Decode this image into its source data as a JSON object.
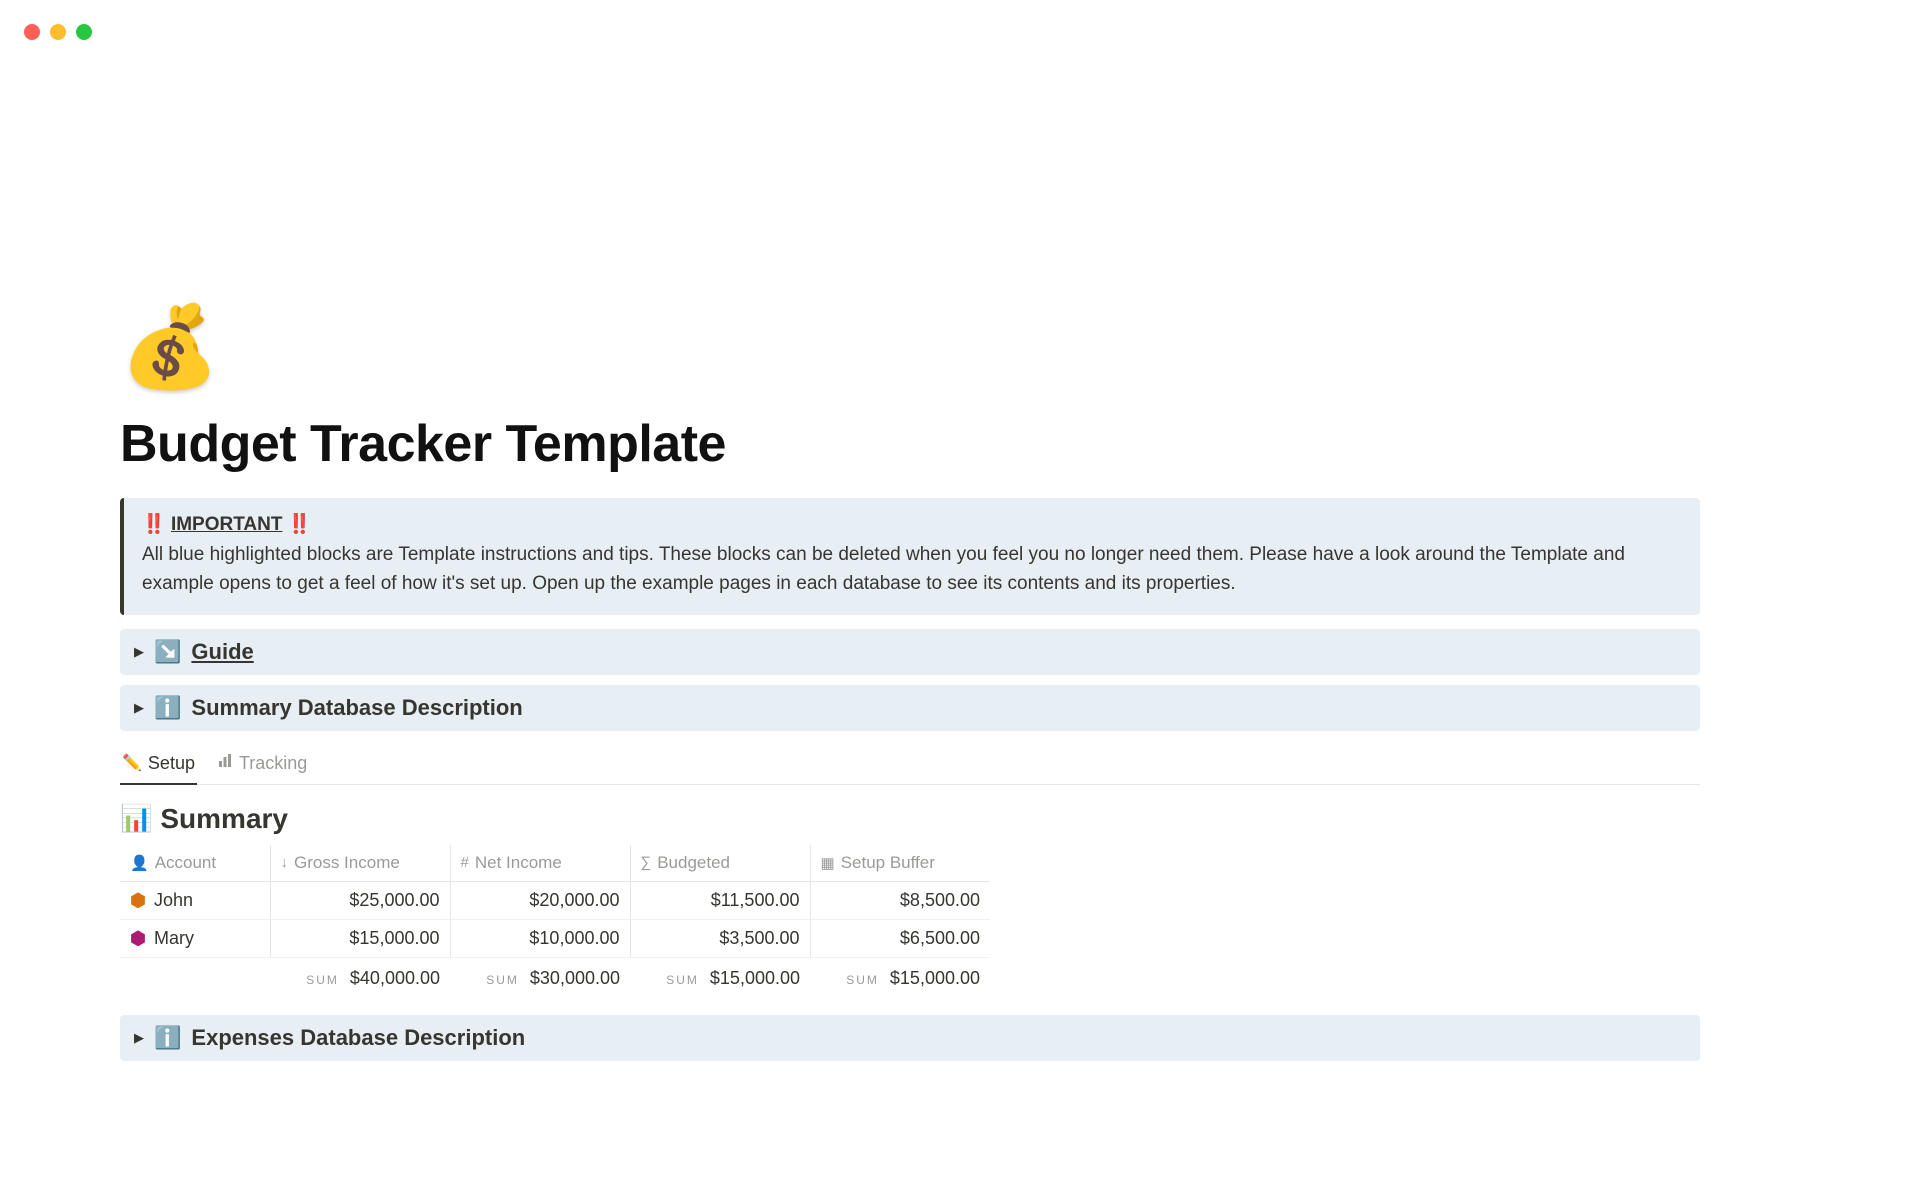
{
  "window": {
    "close": "close",
    "min": "minimize",
    "max": "maximize"
  },
  "page": {
    "icon": "💰",
    "title": "Budget Tracker Template"
  },
  "callout": {
    "alert_emoji": "‼️",
    "title": "IMPORTANT",
    "alert_emoji_2": "‼️",
    "body": "All blue highlighted blocks are Template instructions and tips. These blocks can be deleted when you feel you no longer need them. Please have a look around the Template and example opens to get a feel of how it's set up. Open up the example pages in each database to see its contents and its properties."
  },
  "toggles": {
    "guide": {
      "icon": "↘️",
      "label": "Guide"
    },
    "summary_desc": {
      "icon": "ℹ️",
      "label": "Summary Database Description"
    },
    "expenses_desc": {
      "icon": "ℹ️",
      "label": "Expenses Database Description"
    }
  },
  "tabs": {
    "setup": {
      "icon": "✏️",
      "label": "Setup"
    },
    "tracking": {
      "icon_name": "bar-chart-icon",
      "label": "Tracking"
    }
  },
  "summary": {
    "icon": "📊",
    "title": "Summary",
    "columns": {
      "account": "Account",
      "gross": "Gross Income",
      "net": "Net Income",
      "budgeted": "Budgeted",
      "buffer": "Setup Buffer"
    },
    "rows": [
      {
        "name": "John",
        "hex_color_name": "orange",
        "gross": "$25,000.00",
        "net": "$20,000.00",
        "budgeted": "$11,500.00",
        "buffer": "$8,500.00"
      },
      {
        "name": "Mary",
        "hex_color_name": "pink",
        "gross": "$15,000.00",
        "net": "$10,000.00",
        "budgeted": "$3,500.00",
        "buffer": "$6,500.00"
      }
    ],
    "sum_label": "sum",
    "sums": {
      "gross": "$40,000.00",
      "net": "$30,000.00",
      "budgeted": "$15,000.00",
      "buffer": "$15,000.00"
    }
  }
}
